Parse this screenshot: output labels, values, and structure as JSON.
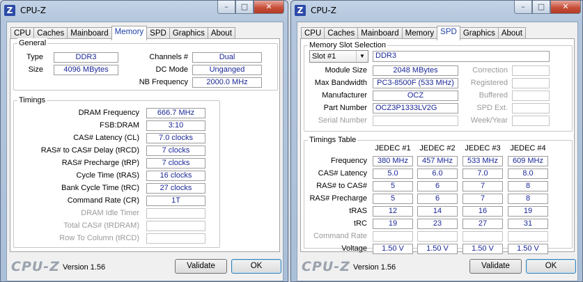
{
  "left_window": {
    "title": "CPU-Z",
    "app_icon": "Z",
    "tabs": [
      "CPU",
      "Caches",
      "Mainboard",
      "Memory",
      "SPD",
      "Graphics",
      "About"
    ],
    "active_tab": "Memory",
    "general": {
      "label": "General",
      "type_label": "Type",
      "type_value": "DDR3",
      "size_label": "Size",
      "size_value": "4096 MBytes",
      "channels_label": "Channels #",
      "channels_value": "Dual",
      "dcmode_label": "DC Mode",
      "dcmode_value": "Unganged",
      "nbfreq_label": "NB Frequency",
      "nbfreq_value": "2000.0 MHz"
    },
    "timings": {
      "label": "Timings",
      "rows": [
        {
          "label": "DRAM Frequency",
          "value": "666.7 MHz"
        },
        {
          "label": "FSB:DRAM",
          "value": "3:10"
        },
        {
          "label": "CAS# Latency (CL)",
          "value": "7.0 clocks"
        },
        {
          "label": "RAS# to CAS# Delay (tRCD)",
          "value": "7 clocks"
        },
        {
          "label": "RAS# Precharge (tRP)",
          "value": "7 clocks"
        },
        {
          "label": "Cycle Time (tRAS)",
          "value": "16 clocks"
        },
        {
          "label": "Bank Cycle Time (tRC)",
          "value": "27 clocks"
        },
        {
          "label": "Command Rate (CR)",
          "value": "1T"
        },
        {
          "label": "DRAM Idle Timer",
          "value": ""
        },
        {
          "label": "Total CAS# (tRDRAM)",
          "value": ""
        },
        {
          "label": "Row To Column (tRCD)",
          "value": ""
        }
      ]
    },
    "logo": "CPU-Z",
    "version": "Version 1.56",
    "validate_label": "Validate",
    "ok_label": "OK"
  },
  "right_window": {
    "title": "CPU-Z",
    "app_icon": "Z",
    "tabs": [
      "CPU",
      "Caches",
      "Mainboard",
      "Memory",
      "SPD",
      "Graphics",
      "About"
    ],
    "active_tab": "SPD",
    "slot": {
      "label": "Memory Slot Selection",
      "selected": "Slot #1",
      "type": "DDR3",
      "rows": [
        {
          "label": "Module Size",
          "value": "2048 MBytes",
          "side_label": "Correction"
        },
        {
          "label": "Max Bandwidth",
          "value": "PC3-8500F (533 MHz)",
          "side_label": "Registered"
        },
        {
          "label": "Manufacturer",
          "value": "OCZ",
          "side_label": "Buffered"
        },
        {
          "label": "Part Number",
          "value": "OCZ3P1333LV2G",
          "side_label": "SPD Ext."
        },
        {
          "label": "Serial Number",
          "value": "",
          "side_label": "Week/Year"
        }
      ]
    },
    "timings_table": {
      "label": "Timings Table",
      "columns": [
        "JEDEC #1",
        "JEDEC #2",
        "JEDEC #3",
        "JEDEC #4"
      ],
      "rows": [
        {
          "label": "Frequency",
          "values": [
            "380 MHz",
            "457 MHz",
            "533 MHz",
            "609 MHz"
          ]
        },
        {
          "label": "CAS# Latency",
          "values": [
            "5.0",
            "6.0",
            "7.0",
            "8.0"
          ]
        },
        {
          "label": "RAS# to CAS#",
          "values": [
            "5",
            "6",
            "7",
            "8"
          ]
        },
        {
          "label": "RAS# Precharge",
          "values": [
            "5",
            "6",
            "7",
            "8"
          ]
        },
        {
          "label": "tRAS",
          "values": [
            "12",
            "14",
            "16",
            "19"
          ]
        },
        {
          "label": "tRC",
          "values": [
            "19",
            "23",
            "27",
            "31"
          ]
        },
        {
          "label": "Command Rate",
          "values": [
            "",
            "",
            "",
            ""
          ]
        },
        {
          "label": "Voltage",
          "values": [
            "1.50 V",
            "1.50 V",
            "1.50 V",
            "1.50 V"
          ]
        }
      ]
    },
    "logo": "CPU-Z",
    "version": "Version 1.56",
    "validate_label": "Validate",
    "ok_label": "OK"
  },
  "window_buttons": {
    "minimize": "–",
    "maximize": "□",
    "close": "✕"
  }
}
